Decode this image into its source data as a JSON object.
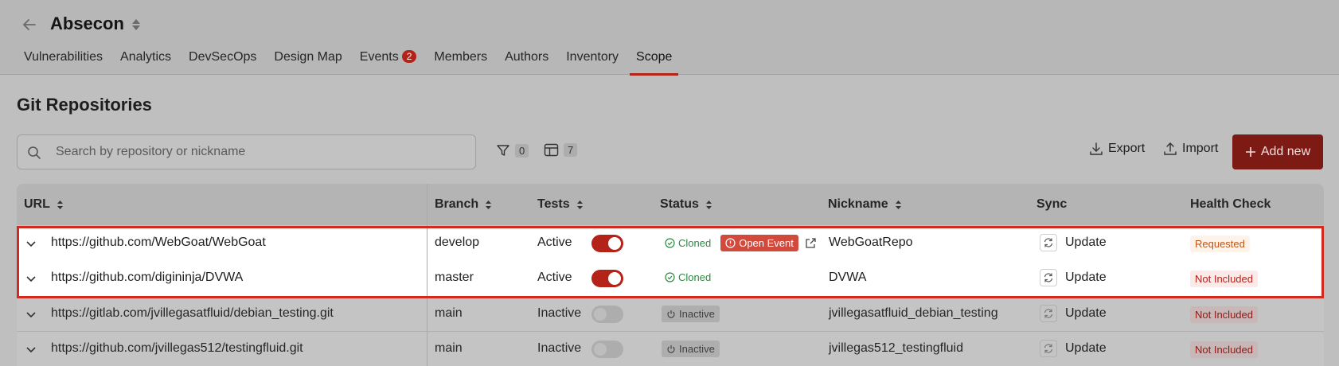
{
  "header": {
    "project_title": "Absecon",
    "tabs": [
      {
        "label": "Vulnerabilities"
      },
      {
        "label": "Analytics"
      },
      {
        "label": "DevSecOps"
      },
      {
        "label": "Design Map"
      },
      {
        "label": "Events",
        "badge": "2"
      },
      {
        "label": "Members"
      },
      {
        "label": "Authors"
      },
      {
        "label": "Inventory"
      },
      {
        "label": "Scope",
        "active": true
      }
    ]
  },
  "section": {
    "title": "Git Repositories"
  },
  "search": {
    "placeholder": "Search by repository or nickname"
  },
  "toolbar": {
    "filter_count": "0",
    "columns_count": "7",
    "export_label": "Export",
    "import_label": "Import",
    "add_label": "Add new"
  },
  "table": {
    "columns": {
      "url": "URL",
      "branch": "Branch",
      "tests": "Tests",
      "status": "Status",
      "nickname": "Nickname",
      "sync": "Sync",
      "health": "Health Check"
    },
    "rows": [
      {
        "url": "https://github.com/WebGoat/WebGoat",
        "branch": "develop",
        "tests": "Active",
        "status": "Cloned",
        "event": "Open Event",
        "nickname": "WebGoatRepo",
        "sync": "Update",
        "health": "Requested"
      },
      {
        "url": "https://github.com/digininja/DVWA",
        "branch": "master",
        "tests": "Active",
        "status": "Cloned",
        "nickname": "DVWA",
        "sync": "Update",
        "health": "Not Included"
      },
      {
        "url": "https://gitlab.com/jvillegasatfluid/debian_testing.git",
        "branch": "main",
        "tests": "Inactive",
        "status": "Inactive",
        "nickname": "jvillegasatfluid_debian_testing",
        "sync": "Update",
        "health": "Not Included"
      },
      {
        "url": "https://github.com/jvillegas512/testingfluid.git",
        "branch": "main",
        "tests": "Inactive",
        "status": "Inactive",
        "nickname": "jvillegas512_testingfluid",
        "sync": "Update",
        "health": "Not Included"
      }
    ]
  },
  "colors": {
    "accent": "#b42318",
    "highlight": "#d32a1f",
    "cloned": "#2a8a3f"
  }
}
